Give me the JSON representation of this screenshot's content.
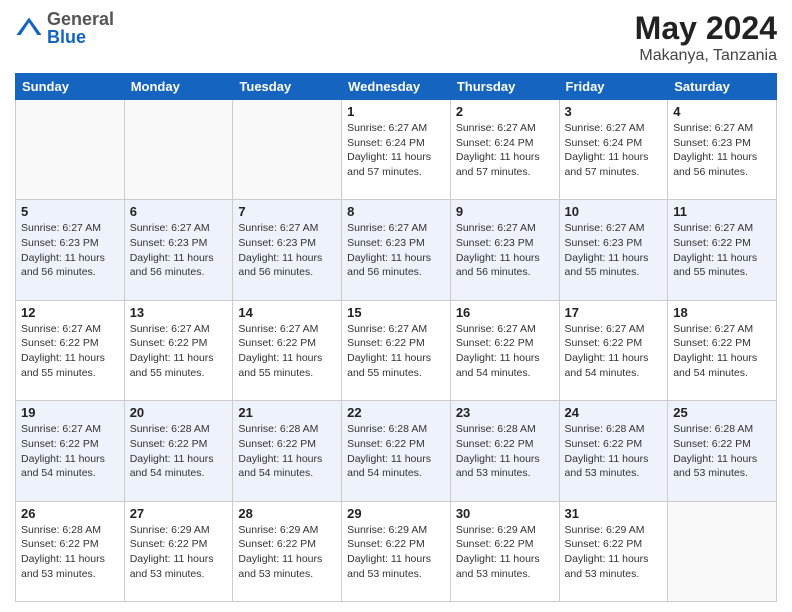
{
  "header": {
    "logo": {
      "general": "General",
      "blue": "Blue"
    },
    "month": "May 2024",
    "location": "Makanya, Tanzania"
  },
  "days_of_week": [
    "Sunday",
    "Monday",
    "Tuesday",
    "Wednesday",
    "Thursday",
    "Friday",
    "Saturday"
  ],
  "weeks": [
    [
      {
        "day": "",
        "info": ""
      },
      {
        "day": "",
        "info": ""
      },
      {
        "day": "",
        "info": ""
      },
      {
        "day": "1",
        "info": "Sunrise: 6:27 AM\nSunset: 6:24 PM\nDaylight: 11 hours and 57 minutes."
      },
      {
        "day": "2",
        "info": "Sunrise: 6:27 AM\nSunset: 6:24 PM\nDaylight: 11 hours and 57 minutes."
      },
      {
        "day": "3",
        "info": "Sunrise: 6:27 AM\nSunset: 6:24 PM\nDaylight: 11 hours and 57 minutes."
      },
      {
        "day": "4",
        "info": "Sunrise: 6:27 AM\nSunset: 6:23 PM\nDaylight: 11 hours and 56 minutes."
      }
    ],
    [
      {
        "day": "5",
        "info": "Sunrise: 6:27 AM\nSunset: 6:23 PM\nDaylight: 11 hours and 56 minutes."
      },
      {
        "day": "6",
        "info": "Sunrise: 6:27 AM\nSunset: 6:23 PM\nDaylight: 11 hours and 56 minutes."
      },
      {
        "day": "7",
        "info": "Sunrise: 6:27 AM\nSunset: 6:23 PM\nDaylight: 11 hours and 56 minutes."
      },
      {
        "day": "8",
        "info": "Sunrise: 6:27 AM\nSunset: 6:23 PM\nDaylight: 11 hours and 56 minutes."
      },
      {
        "day": "9",
        "info": "Sunrise: 6:27 AM\nSunset: 6:23 PM\nDaylight: 11 hours and 56 minutes."
      },
      {
        "day": "10",
        "info": "Sunrise: 6:27 AM\nSunset: 6:23 PM\nDaylight: 11 hours and 55 minutes."
      },
      {
        "day": "11",
        "info": "Sunrise: 6:27 AM\nSunset: 6:22 PM\nDaylight: 11 hours and 55 minutes."
      }
    ],
    [
      {
        "day": "12",
        "info": "Sunrise: 6:27 AM\nSunset: 6:22 PM\nDaylight: 11 hours and 55 minutes."
      },
      {
        "day": "13",
        "info": "Sunrise: 6:27 AM\nSunset: 6:22 PM\nDaylight: 11 hours and 55 minutes."
      },
      {
        "day": "14",
        "info": "Sunrise: 6:27 AM\nSunset: 6:22 PM\nDaylight: 11 hours and 55 minutes."
      },
      {
        "day": "15",
        "info": "Sunrise: 6:27 AM\nSunset: 6:22 PM\nDaylight: 11 hours and 55 minutes."
      },
      {
        "day": "16",
        "info": "Sunrise: 6:27 AM\nSunset: 6:22 PM\nDaylight: 11 hours and 54 minutes."
      },
      {
        "day": "17",
        "info": "Sunrise: 6:27 AM\nSunset: 6:22 PM\nDaylight: 11 hours and 54 minutes."
      },
      {
        "day": "18",
        "info": "Sunrise: 6:27 AM\nSunset: 6:22 PM\nDaylight: 11 hours and 54 minutes."
      }
    ],
    [
      {
        "day": "19",
        "info": "Sunrise: 6:27 AM\nSunset: 6:22 PM\nDaylight: 11 hours and 54 minutes."
      },
      {
        "day": "20",
        "info": "Sunrise: 6:28 AM\nSunset: 6:22 PM\nDaylight: 11 hours and 54 minutes."
      },
      {
        "day": "21",
        "info": "Sunrise: 6:28 AM\nSunset: 6:22 PM\nDaylight: 11 hours and 54 minutes."
      },
      {
        "day": "22",
        "info": "Sunrise: 6:28 AM\nSunset: 6:22 PM\nDaylight: 11 hours and 54 minutes."
      },
      {
        "day": "23",
        "info": "Sunrise: 6:28 AM\nSunset: 6:22 PM\nDaylight: 11 hours and 53 minutes."
      },
      {
        "day": "24",
        "info": "Sunrise: 6:28 AM\nSunset: 6:22 PM\nDaylight: 11 hours and 53 minutes."
      },
      {
        "day": "25",
        "info": "Sunrise: 6:28 AM\nSunset: 6:22 PM\nDaylight: 11 hours and 53 minutes."
      }
    ],
    [
      {
        "day": "26",
        "info": "Sunrise: 6:28 AM\nSunset: 6:22 PM\nDaylight: 11 hours and 53 minutes."
      },
      {
        "day": "27",
        "info": "Sunrise: 6:29 AM\nSunset: 6:22 PM\nDaylight: 11 hours and 53 minutes."
      },
      {
        "day": "28",
        "info": "Sunrise: 6:29 AM\nSunset: 6:22 PM\nDaylight: 11 hours and 53 minutes."
      },
      {
        "day": "29",
        "info": "Sunrise: 6:29 AM\nSunset: 6:22 PM\nDaylight: 11 hours and 53 minutes."
      },
      {
        "day": "30",
        "info": "Sunrise: 6:29 AM\nSunset: 6:22 PM\nDaylight: 11 hours and 53 minutes."
      },
      {
        "day": "31",
        "info": "Sunrise: 6:29 AM\nSunset: 6:22 PM\nDaylight: 11 hours and 53 minutes."
      },
      {
        "day": "",
        "info": ""
      }
    ]
  ]
}
